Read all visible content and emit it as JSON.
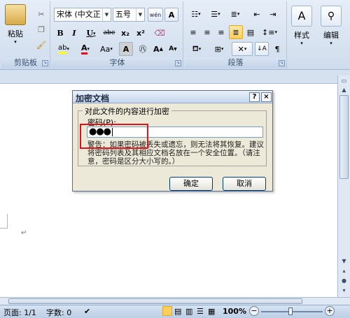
{
  "ribbon": {
    "clipboard": {
      "paste_label": "粘贴",
      "group_label": "剪贴板"
    },
    "font": {
      "font_name": "宋体 (中文正",
      "font_size": "五号",
      "bold": "B",
      "italic": "I",
      "underline": "U",
      "strike": "abe",
      "subscript": "x₂",
      "superscript": "x²",
      "change_case": "Aa",
      "char_border": "A",
      "grow_font": "A",
      "shrink_font": "A",
      "group_label": "字体"
    },
    "paragraph": {
      "group_label": "段落"
    },
    "styles": {
      "label": "样式"
    },
    "editing": {
      "label": "编辑"
    }
  },
  "dialog": {
    "title": "加密文档",
    "help_glyph": "?",
    "close_glyph": "×",
    "legend": "对此文件的内容进行加密",
    "password_label": "密码(P):",
    "password_value": "●●●",
    "warning": "警告：如果密码被丢失或遗忘，则无法将其恢复。建议将密码列表及其相应文档名放在一个安全位置。（请注意，密码是区分大小写的。）",
    "ok": "确定",
    "cancel": "取消"
  },
  "document": {
    "paragraph_mark": "↵"
  },
  "status": {
    "page": "页面: 1/1",
    "words": "字数: 0",
    "zoom": "100%",
    "minus": "−",
    "plus": "+"
  },
  "colors": {
    "highlight_border": "#e0131b",
    "ribbon_bg": "#dbe6f4",
    "dialog_bg": "#ece9d8",
    "active_button": "#ffcf5d"
  }
}
